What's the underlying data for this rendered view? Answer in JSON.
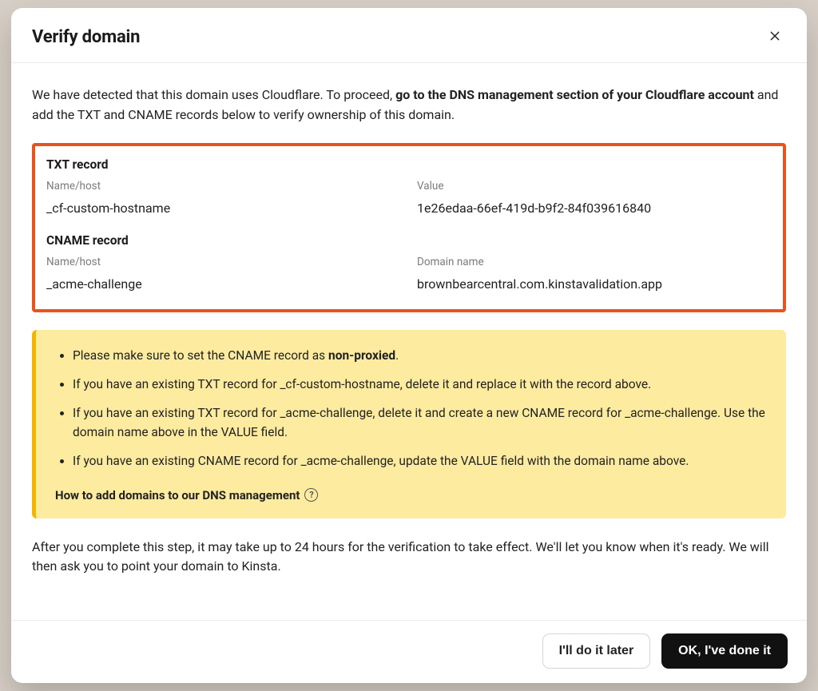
{
  "modal": {
    "title": "Verify domain",
    "intro_plain_pre": "We have detected that this domain uses Cloudflare. To proceed, ",
    "intro_bold": "go to the DNS management section of your Cloudflare account",
    "intro_plain_post": " and add the TXT and CNAME records below to verify ownership of this domain."
  },
  "records": {
    "txt": {
      "title": "TXT record",
      "name_label": "Name/host",
      "name_value": "_cf-custom-hostname",
      "value_label": "Value",
      "value_value": "1e26edaa-66ef-419d-b9f2-84f039616840"
    },
    "cname": {
      "title": "CNAME record",
      "name_label": "Name/host",
      "name_value": "_acme-challenge",
      "value_label": "Domain name",
      "value_value": "brownbearcentral.com.kinstavalidation.app"
    }
  },
  "warning": {
    "items": [
      {
        "pre": "Please make sure to set the CNAME record as ",
        "bold": "non-proxied",
        "post": "."
      },
      {
        "pre": "If you have an existing TXT record for _cf-custom-hostname, delete it and replace it with the record above.",
        "bold": "",
        "post": ""
      },
      {
        "pre": "If you have an existing TXT record for _acme-challenge, delete it and create a new CNAME record for _acme-challenge. Use the domain name above in the VALUE field.",
        "bold": "",
        "post": ""
      },
      {
        "pre": "If you have an existing CNAME record for _acme-challenge, update the VALUE field with the domain name above.",
        "bold": "",
        "post": ""
      }
    ],
    "help_link": "How to add domains to our DNS management"
  },
  "after_text": "After you complete this step, it may take up to 24 hours for the verification to take effect. We'll let you know when it's ready. We will then ask you to point your domain to Kinsta.",
  "footer": {
    "later": "I'll do it later",
    "done": "OK, I've done it"
  },
  "icons": {
    "close": "close-icon",
    "help": "help-icon"
  }
}
